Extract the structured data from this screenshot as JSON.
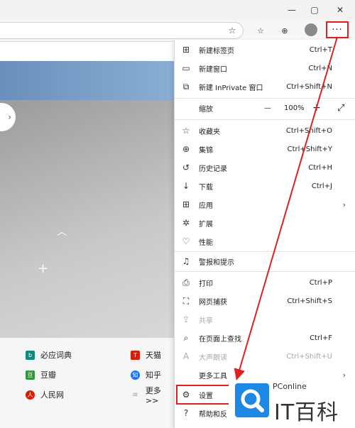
{
  "window": {
    "minimize_label": "—",
    "restore_label": "▢",
    "close_label": "✕"
  },
  "toolbar": {
    "more_label": "···"
  },
  "quick_links": [
    {
      "label": "必应词典",
      "icon_color": "#0e8a7d",
      "icon_glyph": "b"
    },
    {
      "label": "天猫",
      "icon_color": "#d81e06",
      "icon_glyph": "T"
    },
    {
      "label": "豆瓣",
      "icon_color": "#2e963d",
      "icon_glyph": "豆"
    },
    {
      "label": "知乎",
      "icon_color": "#1772f6",
      "icon_glyph": "知"
    },
    {
      "label": "人民网",
      "icon_color": "#d81e06",
      "icon_glyph": "人"
    },
    {
      "label": "更多>>",
      "icon_color": "#9e9e9e",
      "icon_glyph": "≡"
    }
  ],
  "menu": {
    "new_tab": {
      "label": "新建标签页",
      "shortcut": "Ctrl+T"
    },
    "new_window": {
      "label": "新建窗口",
      "shortcut": "Ctrl+N"
    },
    "new_inprivate": {
      "label": "新建 InPrivate 窗口",
      "shortcut": "Ctrl+Shift+N"
    },
    "zoom": {
      "label": "缩放",
      "minus": "—",
      "value": "100%",
      "plus": "+"
    },
    "favorites": {
      "label": "收藏夹",
      "shortcut": "Ctrl+Shift+O"
    },
    "collections": {
      "label": "集锦",
      "shortcut": "Ctrl+Shift+Y"
    },
    "history": {
      "label": "历史记录",
      "shortcut": "Ctrl+H"
    },
    "downloads": {
      "label": "下载",
      "shortcut": "Ctrl+J"
    },
    "apps": {
      "label": "应用"
    },
    "extensions": {
      "label": "扩展"
    },
    "performance": {
      "label": "性能"
    },
    "alerts": {
      "label": "警报和提示"
    },
    "print": {
      "label": "打印",
      "shortcut": "Ctrl+P"
    },
    "web_capture": {
      "label": "网页捕获",
      "shortcut": "Ctrl+Shift+S"
    },
    "share": {
      "label": "共享"
    },
    "find": {
      "label": "在页面上查找",
      "shortcut": "Ctrl+F"
    },
    "read_aloud": {
      "label": "大声朗读",
      "shortcut": "Ctrl+Shift+U"
    },
    "more_tools": {
      "label": "更多工具"
    },
    "settings": {
      "label": "设置"
    },
    "help": {
      "label": "帮助和反"
    }
  },
  "watermark": {
    "brand": "PConline",
    "logo_text": "IT百科"
  },
  "colors": {
    "highlight": "#e02020",
    "watermark_blue": "#1e88e5"
  }
}
